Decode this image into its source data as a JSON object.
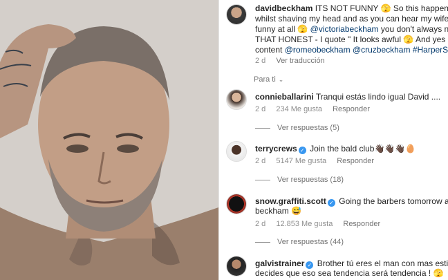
{
  "caption": {
    "username": "davidbeckham",
    "line1": " ITS NOT FUNNY 🫣 So this happened yeste",
    "line2": "whilst shaving my head and as you can hear my wife didn't f",
    "line3_pre": "funny at all 🫣 ",
    "line3_mention": "@victoriabeckham",
    "line3_post": " you don't always need to B",
    "line4": "THAT HONEST - I quote \" It looks awful 🫣 And yes kids have",
    "line5_pre": "content ",
    "mention_romeo": "@romeobeckham",
    "mention_cruz": "@cruzbeckham",
    "tag_harper": "#HarperSeven",
    "line5_post": " 🫣",
    "time": "2 d",
    "translate": "Ver traducción"
  },
  "filter": {
    "label": "Para ti"
  },
  "comments": [
    {
      "username": "connieballarini",
      "verified": false,
      "text": "Tranqui estás lindo igual David ....",
      "time": "2 d",
      "likes": "234 Me gusta",
      "reply": "Responder",
      "view_replies": "Ver respuestas (5)"
    },
    {
      "username": "terrycrews",
      "verified": true,
      "text": "Join the bald club👋🏿👋🏿👋🏿🥚",
      "time": "2 d",
      "likes": "5147 Me gusta",
      "reply": "Responder",
      "view_replies": "Ver respuestas (18)"
    },
    {
      "username": "snow.graffiti.scott",
      "verified": true,
      "text": "Going the barbers tomorrow asking fo",
      "text2": "beckham 😅",
      "time": "2 d",
      "likes": "12.853 Me gusta",
      "reply": "Responder",
      "view_replies": "Ver respuestas (44)"
    },
    {
      "username": "galvistrainer",
      "verified": true,
      "text": "Brother tú eres el man con mas estilo, si",
      "text2": "decides que eso sea tendencia será tendencia ! 🫣"
    }
  ],
  "icons": {
    "verified": "verified-badge-icon",
    "chevron": "chevron-down-icon"
  },
  "colors": {
    "link": "#00376b",
    "verified": "#3897f0",
    "muted": "#8e8e8e"
  }
}
